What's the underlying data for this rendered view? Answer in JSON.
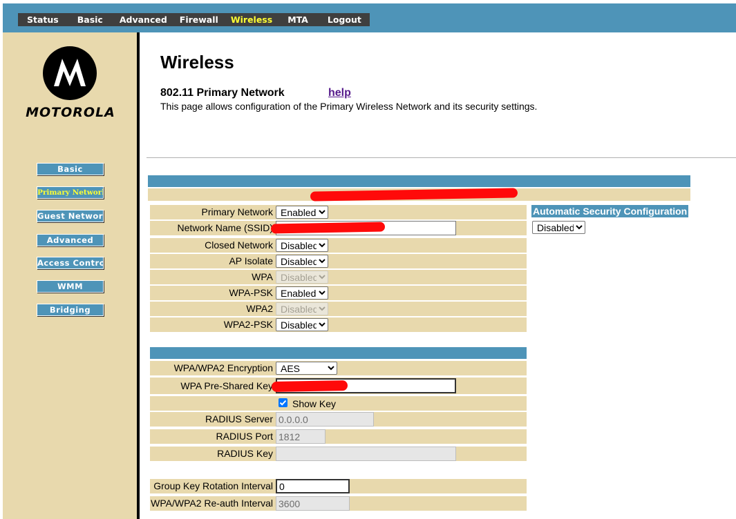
{
  "nav": {
    "items": [
      "Status",
      "Basic",
      "Advanced",
      "Firewall",
      "Wireless",
      "MTA",
      "Logout"
    ],
    "active": "Wireless"
  },
  "sidebar": {
    "brand": "MOTOROLA",
    "items": [
      "Basic",
      "Primary Network",
      "Guest Network",
      "Advanced",
      "Access Control",
      "WMM",
      "Bridging"
    ],
    "active": "Primary Network"
  },
  "page": {
    "title": "Wireless",
    "section": "802.11 Primary Network",
    "help": "help",
    "description": "This page allows configuration of the Primary Wireless Network and its security settings."
  },
  "form": {
    "primary_network": {
      "label": "Primary Network",
      "value": "Enabled"
    },
    "network_name": {
      "label": "Network Name (SSID)"
    },
    "closed_network": {
      "label": "Closed Network",
      "value": "Disabled"
    },
    "ap_isolate": {
      "label": "AP Isolate",
      "value": "Disabled"
    },
    "wpa": {
      "label": "WPA",
      "value": "Disabled"
    },
    "wpa_psk": {
      "label": "WPA-PSK",
      "value": "Enabled"
    },
    "wpa2": {
      "label": "WPA2",
      "value": "Disabled"
    },
    "wpa2_psk": {
      "label": "WPA2-PSK",
      "value": "Disabled"
    },
    "encryption": {
      "label": "WPA/WPA2 Encryption",
      "value": "AES"
    },
    "psk": {
      "label": "WPA Pre-Shared Key"
    },
    "show_key": {
      "label": "Show Key",
      "checked": true
    },
    "radius_server": {
      "label": "RADIUS Server",
      "value": "0.0.0.0"
    },
    "radius_port": {
      "label": "RADIUS Port",
      "value": "1812"
    },
    "radius_key": {
      "label": "RADIUS Key",
      "value": ""
    },
    "group_key_interval": {
      "label": "Group Key Rotation Interval",
      "value": "0"
    },
    "reauth_interval": {
      "label": "WPA/WPA2 Re-auth Interval",
      "value": "3600"
    }
  },
  "auto_security": {
    "label": "Automatic Security Configuration",
    "value": "Disabled"
  },
  "colors": {
    "header_blue": "#4e94b8",
    "sidebar_tan": "#e8d9ad",
    "active_yellow": "#ffff33",
    "redaction_red": "#ff0a0a"
  }
}
